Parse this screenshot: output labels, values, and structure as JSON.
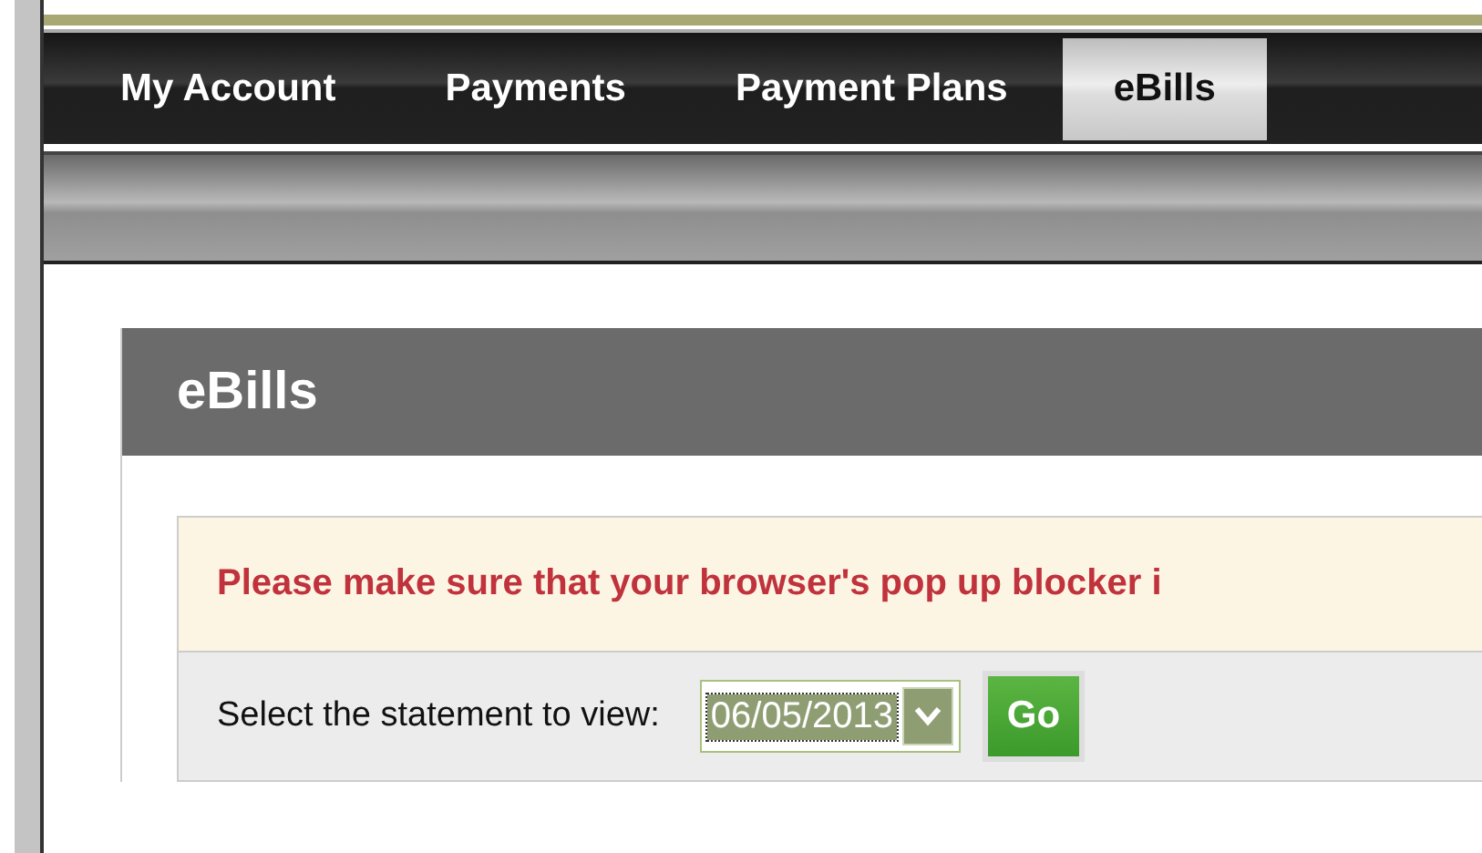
{
  "tabs": [
    {
      "label": "My Account",
      "selected": false
    },
    {
      "label": "Payments",
      "selected": false
    },
    {
      "label": "Payment Plans",
      "selected": false
    },
    {
      "label": "eBills",
      "selected": true
    }
  ],
  "panel": {
    "title": "eBills",
    "notice": "Please make sure that your browser's pop up blocker i",
    "statement_label": "Select the statement to view:",
    "statement_select": {
      "value": "06/05/2013"
    },
    "go_button": "Go"
  }
}
